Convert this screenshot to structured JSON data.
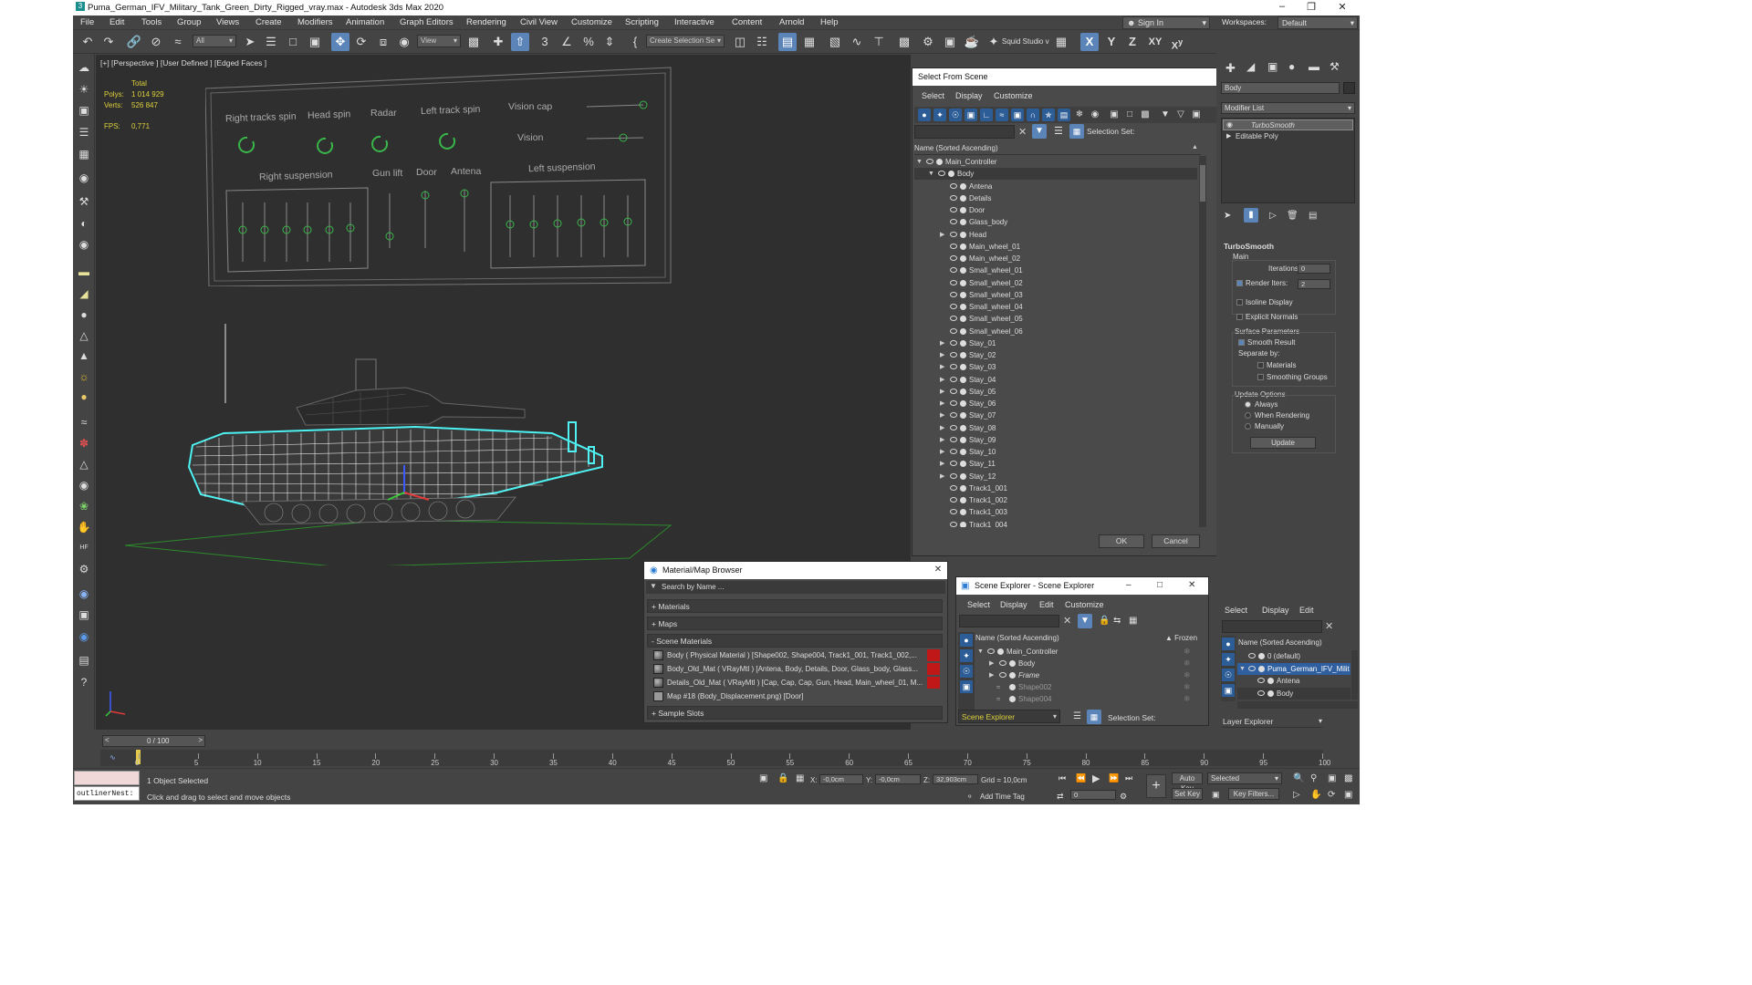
{
  "window": {
    "title": "Puma_German_IFV_Military_Tank_Green_Dirty_Rigged_vray.max - Autodesk 3ds Max 2020",
    "sign_in": "Sign In",
    "workspaces_label": "Workspaces:",
    "workspace_value": "Default"
  },
  "menu": [
    "File",
    "Edit",
    "Tools",
    "Group",
    "Views",
    "Create",
    "Modifiers",
    "Animation",
    "Graph Editors",
    "Rendering",
    "Civil View",
    "Customize",
    "Scripting",
    "Interactive",
    "Content",
    "Arnold",
    "Help"
  ],
  "toolbar": {
    "filter_all": "All",
    "view": "View",
    "create_selection_set": "Create Selection Se",
    "squid_studio": "Squid Studio v",
    "axes": [
      "X",
      "Y",
      "Z",
      "XY"
    ],
    "snap_labels": [
      "3",
      "2"
    ]
  },
  "viewport": {
    "label": "[+] [Perspective ] [User Defined ] [Edged Faces ]",
    "stats_total": "Total",
    "polys_label": "Polys:",
    "polys_value": "1 014 929",
    "verts_label": "Verts:",
    "verts_value": "526 847",
    "fps_label": "FPS:",
    "fps_value": "0,771"
  },
  "rig_panel": {
    "labels": [
      "Right tracks spin",
      "Head spin",
      "Radar",
      "Left track spin",
      "Vision cap",
      "Vision",
      "Right suspension",
      "Gun lift",
      "Door",
      "Antena",
      "Left suspension"
    ]
  },
  "select_from_scene": {
    "title": "Select From Scene",
    "menu": [
      "Select",
      "Display",
      "Customize"
    ],
    "selection_set_label": "Selection Set:",
    "header": "Name (Sorted Ascending)",
    "items": [
      {
        "name": "Main_Controller",
        "level": 0,
        "expand": "open"
      },
      {
        "name": "Body",
        "level": 1,
        "expand": "open"
      },
      {
        "name": "Antena",
        "level": 2,
        "expand": ""
      },
      {
        "name": "Details",
        "level": 2,
        "expand": ""
      },
      {
        "name": "Door",
        "level": 2,
        "expand": ""
      },
      {
        "name": "Glass_body",
        "level": 2,
        "expand": ""
      },
      {
        "name": "Head",
        "level": 2,
        "expand": "closed"
      },
      {
        "name": "Main_wheel_01",
        "level": 2,
        "expand": ""
      },
      {
        "name": "Main_wheel_02",
        "level": 2,
        "expand": ""
      },
      {
        "name": "Small_wheel_01",
        "level": 2,
        "expand": ""
      },
      {
        "name": "Small_wheel_02",
        "level": 2,
        "expand": ""
      },
      {
        "name": "Small_wheel_03",
        "level": 2,
        "expand": ""
      },
      {
        "name": "Small_wheel_04",
        "level": 2,
        "expand": ""
      },
      {
        "name": "Small_wheel_05",
        "level": 2,
        "expand": ""
      },
      {
        "name": "Small_wheel_06",
        "level": 2,
        "expand": ""
      },
      {
        "name": "Stay_01",
        "level": 2,
        "expand": "closed"
      },
      {
        "name": "Stay_02",
        "level": 2,
        "expand": "closed"
      },
      {
        "name": "Stay_03",
        "level": 2,
        "expand": "closed"
      },
      {
        "name": "Stay_04",
        "level": 2,
        "expand": "closed"
      },
      {
        "name": "Stay_05",
        "level": 2,
        "expand": "closed"
      },
      {
        "name": "Stay_06",
        "level": 2,
        "expand": "closed"
      },
      {
        "name": "Stay_07",
        "level": 2,
        "expand": "closed"
      },
      {
        "name": "Stay_08",
        "level": 2,
        "expand": "closed"
      },
      {
        "name": "Stay_09",
        "level": 2,
        "expand": "closed"
      },
      {
        "name": "Stay_10",
        "level": 2,
        "expand": "closed"
      },
      {
        "name": "Stay_11",
        "level": 2,
        "expand": "closed"
      },
      {
        "name": "Stay_12",
        "level": 2,
        "expand": "closed"
      },
      {
        "name": "Track1_001",
        "level": 2,
        "expand": ""
      },
      {
        "name": "Track1_002",
        "level": 2,
        "expand": ""
      },
      {
        "name": "Track1_003",
        "level": 2,
        "expand": ""
      },
      {
        "name": "Track1_004",
        "level": 2,
        "expand": ""
      }
    ],
    "ok": "OK",
    "cancel": "Cancel"
  },
  "material_browser": {
    "title": "Material/Map Browser",
    "search_placeholder": "Search by Name ...",
    "sections": [
      "+ Materials",
      "+ Maps",
      "- Scene Materials"
    ],
    "materials": [
      "Body  ( Physical Material )  [Shape002, Shape004, Track1_001, Track1_002,...",
      "Body_Old_Mat  ( VRayMtl )  [Antena, Body, Details, Door, Glass_body, Glass...",
      "Details_Old_Mat  ( VRayMtl )  [Cap, Cap, Cap, Gun, Head, Main_wheel_01, M...",
      "Map #18 (Body_Displacement.png)  [Door]"
    ],
    "sample_slots": "+ Sample Slots"
  },
  "scene_explorer": {
    "title": "Scene Explorer - Scene Explorer",
    "menu": [
      "Select",
      "Display",
      "Edit",
      "Customize"
    ],
    "header": "Name (Sorted Ascending)",
    "frozen_header": "▲ Frozen",
    "items": [
      {
        "name": "Main_Controller",
        "level": 0
      },
      {
        "name": "Body",
        "level": 1
      },
      {
        "name": "Frame",
        "level": 1
      },
      {
        "name": "Shape002",
        "level": 1
      },
      {
        "name": "Shape004",
        "level": 1
      }
    ],
    "footer_dropdown": "Scene Explorer",
    "selection_set_label": "Selection Set:"
  },
  "command_panel": {
    "object_name": "Body",
    "modifier_list": "Modifier List",
    "stack": [
      "TurboSmooth",
      "Editable Poly"
    ],
    "rollout_title": "TurboSmooth",
    "main_label": "Main",
    "iterations_label": "Iterations:",
    "iterations_value": "0",
    "render_iters_label": "Render Iters:",
    "render_iters_value": "2",
    "isoline_display": "Isoline Display",
    "explicit_normals": "Explicit Normals",
    "surface_parameters": "Surface Parameters",
    "smooth_result": "Smooth Result",
    "separate_by": "Separate by:",
    "materials": "Materials",
    "smoothing_groups": "Smoothing Groups",
    "update_options": "Update Options",
    "always": "Always",
    "when_rendering": "When Rendering",
    "manually": "Manually",
    "update_button": "Update"
  },
  "layer_explorer": {
    "menu": [
      "Select",
      "Display",
      "Edit"
    ],
    "header": "Name (Sorted Ascending)",
    "items": [
      {
        "name": "0 (default)",
        "level": 0
      },
      {
        "name": "Puma_German_IFV_Milit",
        "level": 0
      },
      {
        "name": "Antena",
        "level": 1
      },
      {
        "name": "Body",
        "level": 1
      }
    ],
    "footer": "Layer Explorer"
  },
  "timeline": {
    "frame_counter": "0 / 100",
    "ticks": [
      "0",
      "5",
      "10",
      "15",
      "20",
      "25",
      "30",
      "35",
      "40",
      "45",
      "50",
      "55",
      "60",
      "65",
      "70",
      "75",
      "80",
      "85",
      "90",
      "95",
      "100"
    ]
  },
  "status": {
    "script_box": "outlinerNest:",
    "selected": "1 Object Selected",
    "prompt": "Click and drag to select and move objects",
    "x_label": "X:",
    "x_value": "-0,0cm",
    "y_label": "Y:",
    "y_value": "-0,0cm",
    "z_label": "Z:",
    "z_value": "32,903cm",
    "grid": "Grid = 10,0cm",
    "add_time_tag": "Add Time Tag",
    "auto_key": "Auto Key",
    "set_key": "Set Key",
    "selected_dropdown": "Selected",
    "key_filters": "Key Filters...",
    "frame_value": "0"
  },
  "colors": {
    "accent_blue": "#5b85b8",
    "rig_green": "#39b54a",
    "wire_cyan": "#4ef2f2",
    "stats_yellow": "#dcd03a"
  }
}
